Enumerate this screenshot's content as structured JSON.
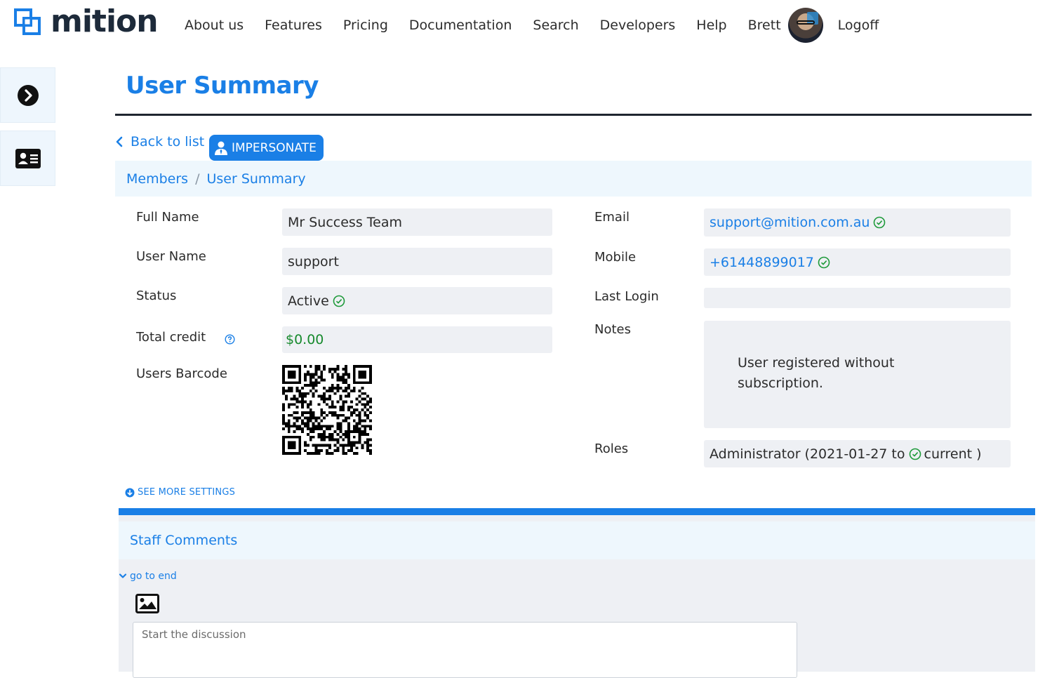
{
  "brand": {
    "name": "mition",
    "accent": "#1a7fe6"
  },
  "nav": {
    "items": [
      "About us",
      "Features",
      "Pricing",
      "Documentation",
      "Search",
      "Developers",
      "Help",
      "Brett"
    ],
    "logoff": "Logoff"
  },
  "header": {
    "title": "User Summary",
    "back_label": "Back to list",
    "impersonate_label": "IMPERSONATE"
  },
  "breadcrumb": {
    "items": [
      "Members",
      "User Summary"
    ],
    "separator": "/"
  },
  "user": {
    "full_name_label": "Full Name",
    "full_name": "Mr Success Team",
    "user_name_label": "User Name",
    "user_name": "support",
    "status_label": "Status",
    "status": "Active",
    "credit_label": "Total credit",
    "credit": "$0.00",
    "barcode_label": "Users Barcode",
    "email_label": "Email",
    "email": "support@mition.com.au",
    "mobile_label": "Mobile",
    "mobile": "+61448899017",
    "last_login_label": "Last Login",
    "last_login": "",
    "notes_label": "Notes",
    "notes": "User registered without subscription.",
    "roles_label": "Roles",
    "role": {
      "prefix": "Administrator (2021-01-27 to",
      "suffix": "current )"
    }
  },
  "see_more": "SEE MORE SETTINGS",
  "comments": {
    "title": "Staff Comments",
    "go_to_end": "go to end",
    "placeholder": "Start the discussion"
  }
}
